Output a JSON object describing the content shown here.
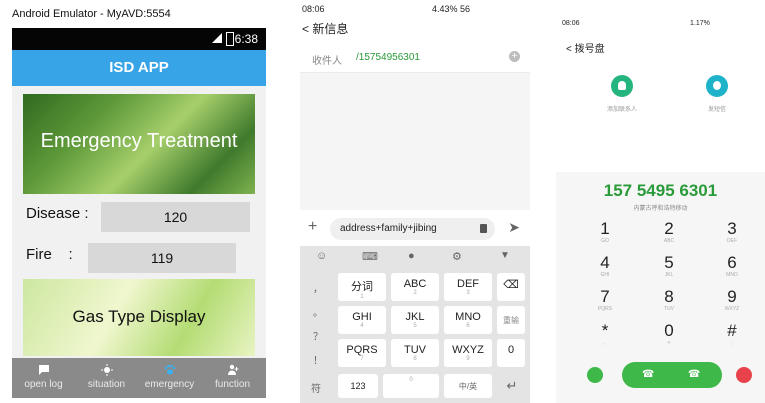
{
  "emulator": {
    "window_title": "Android Emulator - MyAVD:5554",
    "status_time": "6:38",
    "app_title": "ISD APP",
    "banner_text": "Emergency Treatment",
    "disease_label": "Disease :",
    "disease_value": "120",
    "fire_label": "Fire    :",
    "fire_value": "119",
    "gas_banner_text": "Gas Type Display",
    "nav": [
      {
        "label": "open log",
        "icon": "chat-icon"
      },
      {
        "label": "situation",
        "icon": "sun-icon"
      },
      {
        "label": "emergency",
        "icon": "paw-icon"
      },
      {
        "label": "function",
        "icon": "person-add-icon"
      }
    ]
  },
  "sms": {
    "status_time": "08:06",
    "status_right": "4.43% 56",
    "title": "< 新信息",
    "recipient_label": "收件人",
    "recipient_value": "/15754956301",
    "compose_text": "address+family+jibing",
    "keyboard": {
      "top_row_icons": [
        "emoji-icon",
        "keyboard-icon",
        "mic-icon",
        "settings-icon",
        "collapse-icon"
      ],
      "left_column": [
        "，",
        "。",
        "？",
        "！"
      ],
      "keys": [
        {
          "main": "分词",
          "sub": "1"
        },
        {
          "main": "ABC",
          "sub": "2"
        },
        {
          "main": "DEF",
          "sub": "3"
        },
        {
          "main": "GHI",
          "sub": "4"
        },
        {
          "main": "JKL",
          "sub": "5"
        },
        {
          "main": "MNO",
          "sub": "6"
        },
        {
          "main": "PQRS",
          "sub": "7"
        },
        {
          "main": "TUV",
          "sub": "8"
        },
        {
          "main": "WXYZ",
          "sub": "9"
        }
      ],
      "right_column": [
        "⌫",
        "重输",
        "0"
      ],
      "bottom_row": [
        "符",
        "123",
        "0",
        "中/英",
        "↵"
      ]
    }
  },
  "dialer": {
    "status_time": "08:06",
    "status_right": "1.17%",
    "title": "< 拨号盘",
    "action_add": "添加联系人",
    "action_sms": "发短信",
    "number": "157 5495 6301",
    "location": "内蒙古呼和浩特移动",
    "keys": [
      {
        "n": "1",
        "s": "GO"
      },
      {
        "n": "2",
        "s": "ABC"
      },
      {
        "n": "3",
        "s": "DEF"
      },
      {
        "n": "4",
        "s": "GHI"
      },
      {
        "n": "5",
        "s": "JKL"
      },
      {
        "n": "6",
        "s": "MNO"
      },
      {
        "n": "7",
        "s": "PQRS"
      },
      {
        "n": "8",
        "s": "TUV"
      },
      {
        "n": "9",
        "s": "WXYZ"
      },
      {
        "n": "*",
        "s": ","
      },
      {
        "n": "0",
        "s": "+"
      },
      {
        "n": "#",
        "s": ";"
      }
    ],
    "colors": {
      "green": "#3fb84a",
      "red": "#e8434c",
      "number": "#2a9a3a"
    }
  }
}
